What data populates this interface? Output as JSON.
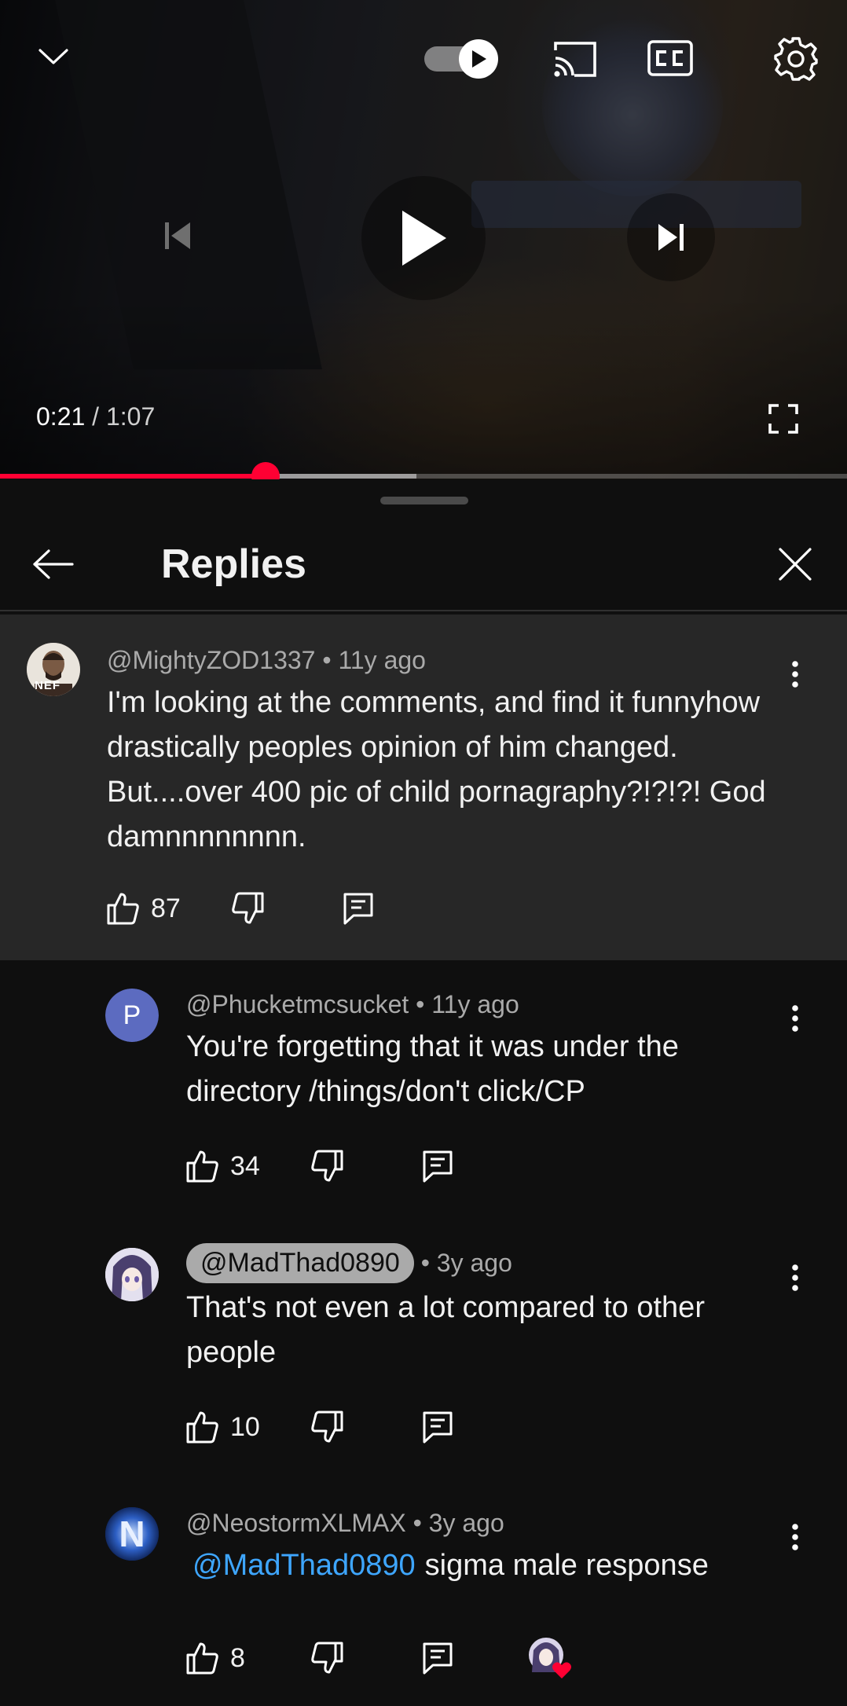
{
  "player": {
    "current_time": "0:21",
    "duration": "1:07",
    "played_fraction": 0.314,
    "buffered_fraction": 0.492,
    "autoplay_on": true
  },
  "replies_panel": {
    "title": "Replies"
  },
  "parent_comment": {
    "author": "@MightyZOD1337",
    "age": "• 11y ago",
    "text": "I'm looking at the comments, and find it funnyhow drastically peoples opinion of him changed. But....over 400 pic of child pornagraphy?!?!?! God damnnnnnnnn.",
    "likes": "87",
    "avatar_text": "NEF"
  },
  "replies": [
    {
      "author": "@Phucketmcsucket",
      "age": "• 11y ago",
      "text": "You're forgetting that it was under the directory /things/don't click/CP",
      "likes": "34",
      "avatar_letter": "P",
      "avatar_color": "#5c6bc0"
    },
    {
      "author": "@MadThad0890",
      "age": "• 3y ago",
      "text": "That's not even a lot compared to other people",
      "likes": "10"
    },
    {
      "author": "@NeostormXLMAX",
      "age": "• 3y ago",
      "mention": "@MadThad0890",
      "text": "sigma male response",
      "likes": "8",
      "avatar_letter": "N"
    }
  ],
  "colors": {
    "accent_red": "#ff0033",
    "mention_blue": "#3ea6ff",
    "parent_bg": "#272727",
    "page_bg": "#0f0f0f"
  },
  "icons": [
    "chevron-down-icon",
    "autoplay-toggle",
    "cast-icon",
    "captions-icon",
    "settings-icon",
    "previous-icon",
    "play-icon",
    "next-icon",
    "fullscreen-icon",
    "back-arrow-icon",
    "close-icon",
    "more-vert-icon",
    "thumb-up-icon",
    "thumb-down-icon",
    "reply-icon",
    "creator-heart-icon"
  ]
}
